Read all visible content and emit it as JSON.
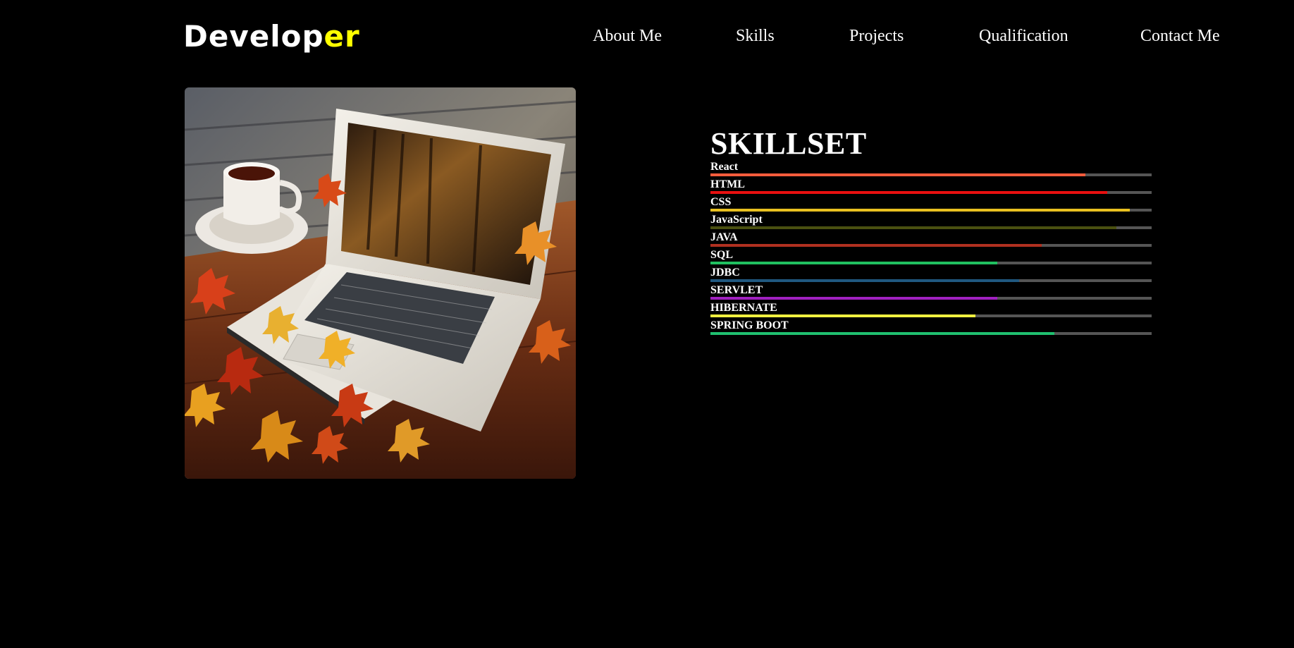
{
  "brand": {
    "prefix": "Develop",
    "highlight": "er",
    "highlight_color": "#ffff00"
  },
  "nav": {
    "items": [
      {
        "label": "About Me"
      },
      {
        "label": "Skills"
      },
      {
        "label": "Projects"
      },
      {
        "label": "Qualification"
      },
      {
        "label": "Contact Me"
      }
    ]
  },
  "hero": {
    "image": "laptop-autumn-leaves-coffee-illustration"
  },
  "skillset": {
    "title": "SKILLSET",
    "track_color": "#555555",
    "skills": [
      {
        "label": "React",
        "level": 0.85,
        "color": "#ff5c3c"
      },
      {
        "label": "HTML",
        "level": 0.9,
        "color": "#e81010"
      },
      {
        "label": "CSS",
        "level": 0.95,
        "color": "#e8c020"
      },
      {
        "label": "JavaScript",
        "level": 0.92,
        "color": "#4a5010"
      },
      {
        "label": "JAVA",
        "level": 0.75,
        "color": "#b03020"
      },
      {
        "label": "SQL",
        "level": 0.65,
        "color": "#20c060"
      },
      {
        "label": "JDBC",
        "level": 0.7,
        "color": "#205880"
      },
      {
        "label": "SERVLET",
        "level": 0.65,
        "color": "#a020c0"
      },
      {
        "label": "HIBERNATE",
        "level": 0.6,
        "color": "#f0f040"
      },
      {
        "label": "SPRING BOOT",
        "level": 0.78,
        "color": "#20c070"
      }
    ]
  }
}
